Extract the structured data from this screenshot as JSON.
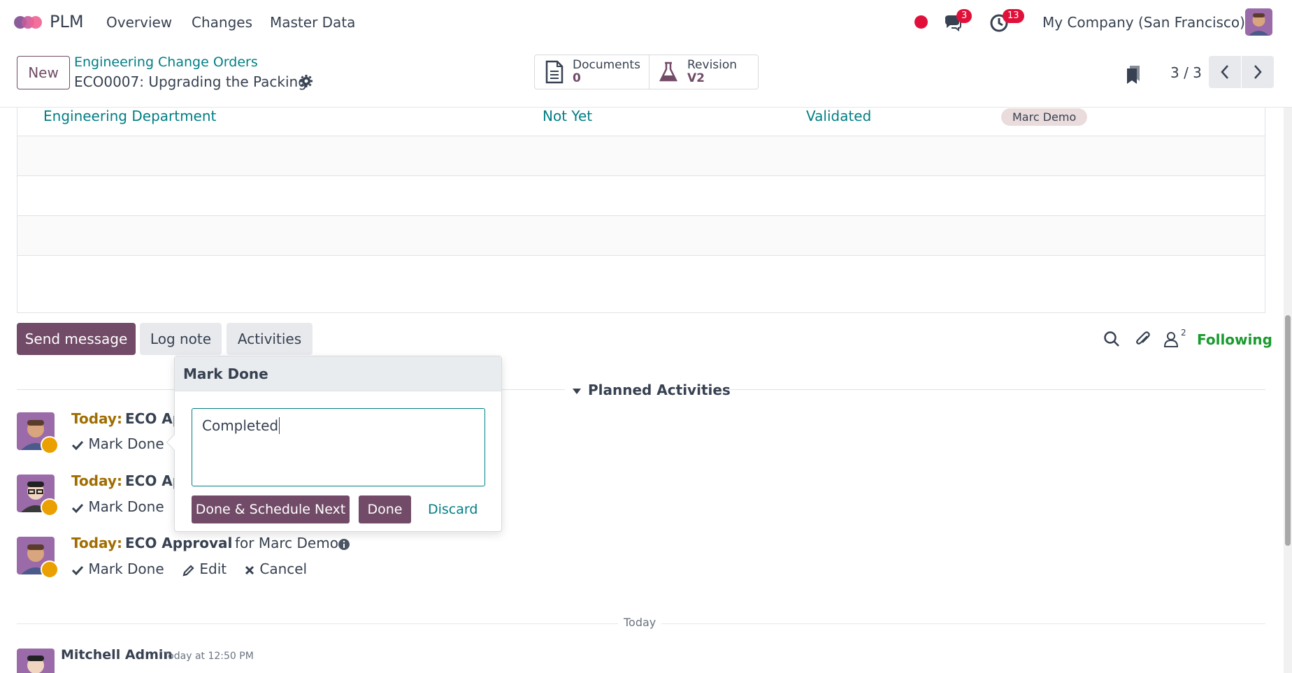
{
  "navbar": {
    "app_name": "PLM",
    "menu": [
      "Overview",
      "Changes",
      "Master Data"
    ],
    "messages_count": "3",
    "activities_count": "13",
    "company": "My Company (San Francisco)"
  },
  "control_panel": {
    "new_label": "New",
    "breadcrumb": "Engineering Change Orders",
    "record_title": "ECO0007: Upgrading the Packing",
    "smart_buttons": [
      {
        "title": "Documents",
        "value": "0"
      },
      {
        "title": "Revision",
        "value": "V2"
      }
    ],
    "pager": "3 / 3"
  },
  "table": {
    "rows": [
      {
        "team": "Engineering Department",
        "status": "Not Yet",
        "validation": "Validated",
        "user": "Marc Demo"
      }
    ]
  },
  "chatter": {
    "send_message": "Send message",
    "log_note": "Log note",
    "activities": "Activities",
    "followers_count": "2",
    "following": "Following",
    "planned_activities": "Planned Activities",
    "activities_list": [
      {
        "today": "Today:",
        "name": "ECO Ap",
        "for": "",
        "mark_done": "Mark Done"
      },
      {
        "today": "Today:",
        "name": "ECO Ap",
        "for": "",
        "mark_done": "Mark Done"
      },
      {
        "today": "Today:",
        "name": "ECO Approval",
        "for": "for Marc Demo",
        "mark_done": "Mark Done",
        "edit": "Edit",
        "cancel": "Cancel"
      }
    ],
    "today_separator": "Today",
    "message": {
      "author": "Mitchell Admin",
      "time": "Today at 12:50 PM"
    }
  },
  "popover": {
    "title": "Mark Done",
    "feedback_value": "Completed",
    "done_schedule_next": "Done & Schedule Next",
    "done": "Done",
    "discard": "Discard"
  },
  "colors": {
    "brand": "#714b67",
    "link": "#017e84",
    "following": "#1a9b2f",
    "badge": "#e0103a",
    "activity_today": "#a06d00"
  },
  "icons": [
    "plm-logo-icon",
    "record-dot-icon",
    "chat-icon",
    "clock-icon",
    "gear-icon",
    "document-icon",
    "flask-icon",
    "bookmark-icon",
    "chevron-left-icon",
    "chevron-right-icon",
    "search-icon",
    "paperclip-icon",
    "user-icon",
    "caret-down-icon",
    "check-icon",
    "pencil-icon",
    "x-icon",
    "info-icon"
  ]
}
